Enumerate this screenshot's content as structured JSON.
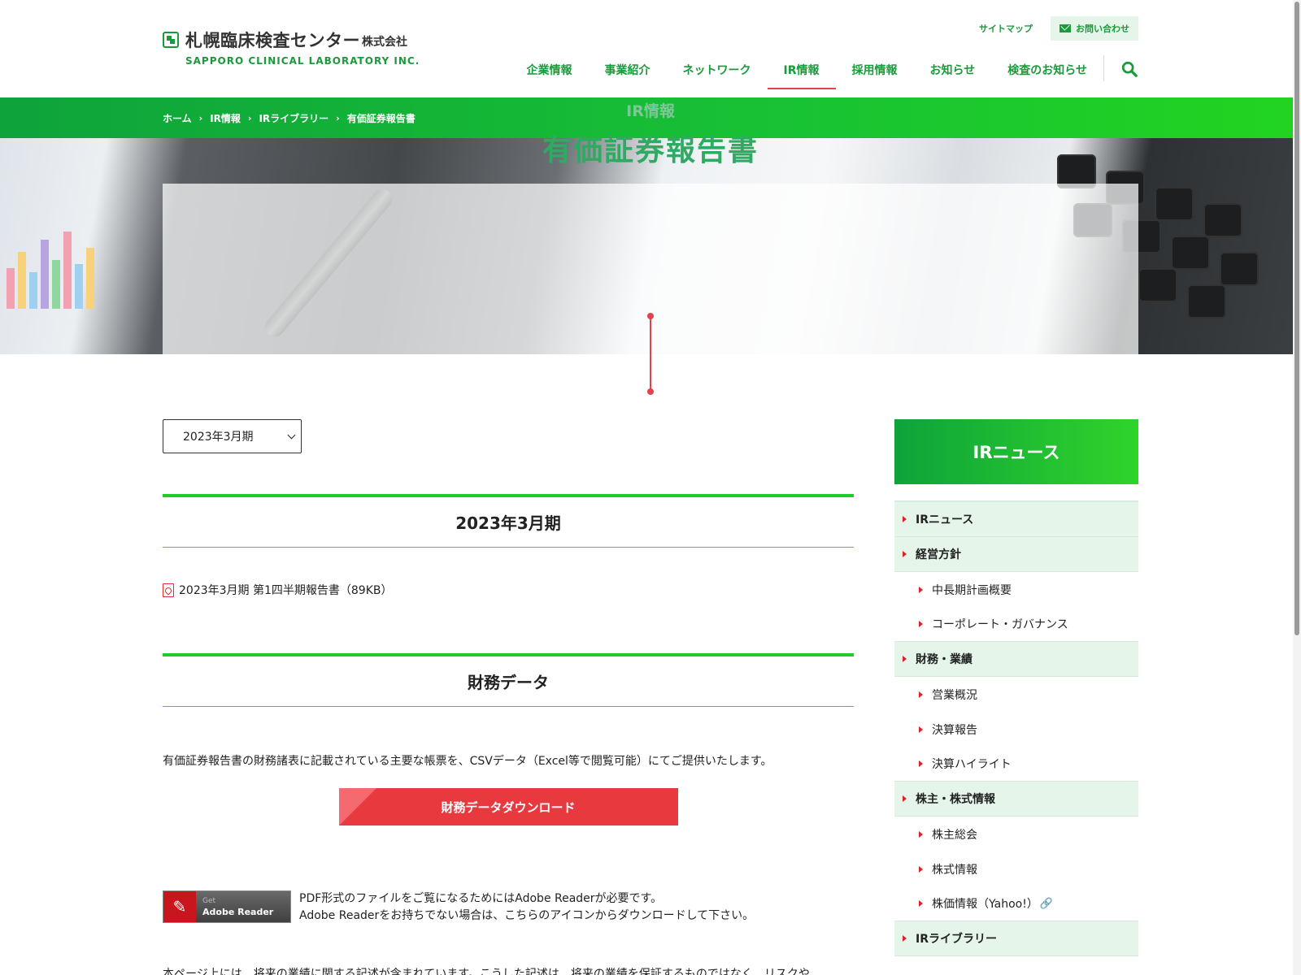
{
  "header": {
    "logo_jp": "札幌臨床検査センター",
    "logo_jp_suffix": "株式会社",
    "logo_en": "SAPPORO CLINICAL LABORATORY INC.",
    "sitemap_label": "サイトマップ",
    "contact_label": "お問い合わせ",
    "nav": [
      "企業情報",
      "事業紹介",
      "ネットワーク",
      "IR情報",
      "採用情報",
      "お知らせ",
      "検査のお知らせ"
    ],
    "active_nav": "IR情報"
  },
  "breadcrumb": [
    "ホーム",
    "IR情報",
    "IRライブラリー",
    "有価証券報告書"
  ],
  "hero": {
    "subtitle": "IR情報",
    "title": "有価証券報告書"
  },
  "main": {
    "select_value": "2023年3月期",
    "section1_title": "2023年3月期",
    "pdf_link": "2023年3月期 第1四半期報告書（89KB）",
    "section2_title": "財務データ",
    "description": "有価証券報告書の財務諸表に記載されている主要な帳票を、CSVデータ（Excel等で閲覧可能）にてご提供いたします。",
    "download_button": "財務データダウンロード",
    "adobe_get": "Get",
    "adobe_name": "Adobe Reader",
    "adobe_line1": "PDF形式のファイルをご覧になるためにはAdobe Readerが必要です。",
    "adobe_line2": "Adobe Readerをお持ちでない場合は、こちらのアイコンからダウンロードして下さい。",
    "notice": "本ページ上には、将来の業績に関する記述が含まれています。こうした記述は、将来の業績を保証するものではなく、リスクや"
  },
  "sidebar": {
    "title": "IRニュース",
    "items": [
      {
        "label": "IRニュース",
        "level": 1
      },
      {
        "label": "経営方針",
        "level": 1
      },
      {
        "label": "中長期計画概要",
        "level": 2
      },
      {
        "label": "コーポレート・ガバナンス",
        "level": 2
      },
      {
        "label": "財務・業績",
        "level": 1
      },
      {
        "label": "営業概況",
        "level": 2
      },
      {
        "label": "決算報告",
        "level": 2
      },
      {
        "label": "決算ハイライト",
        "level": 2
      },
      {
        "label": "株主・株式情報",
        "level": 1
      },
      {
        "label": "株主総会",
        "level": 2
      },
      {
        "label": "株式情報",
        "level": 2
      },
      {
        "label": "株価情報（Yahoo!）",
        "level": 2
      },
      {
        "label": "IRライブラリー",
        "level": 1
      }
    ]
  },
  "colors": {
    "brand_green": "#1a9a3a",
    "accent_red": "#e84048"
  }
}
